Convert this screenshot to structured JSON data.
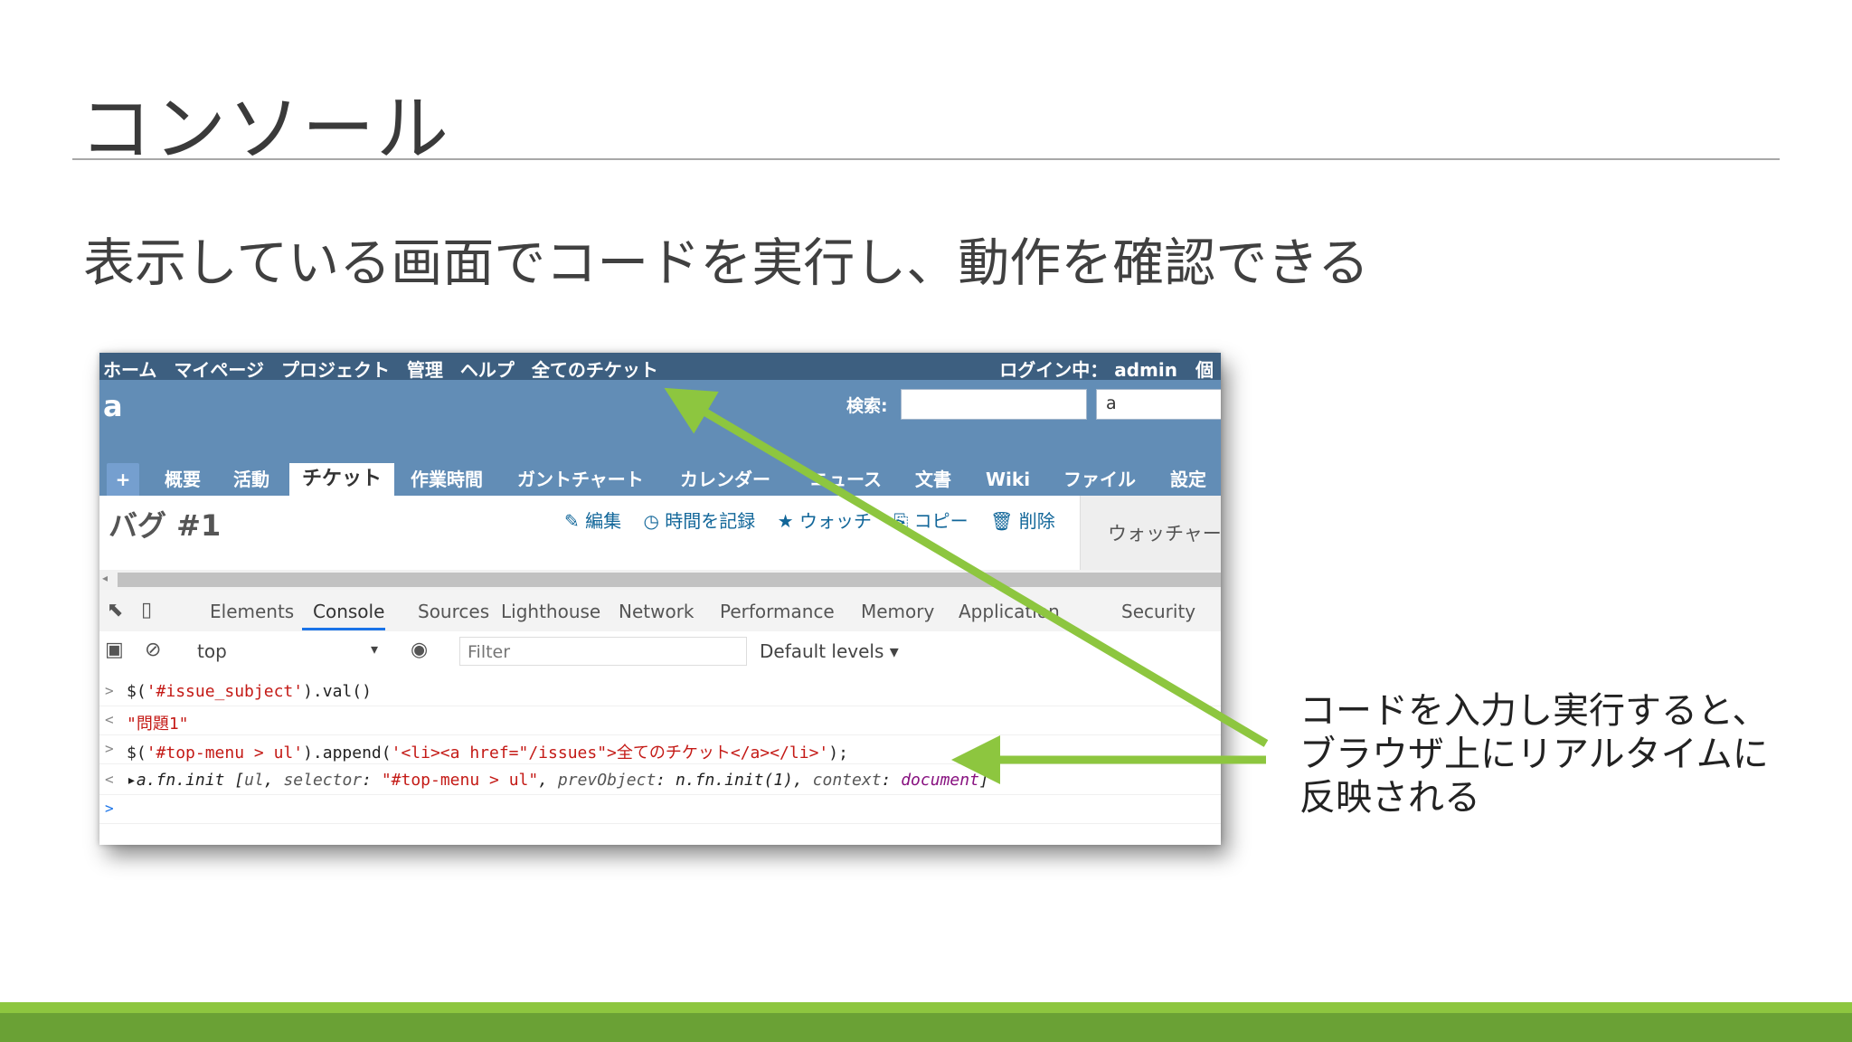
{
  "slide": {
    "title": "コンソール",
    "subtitle": "表示している画面でコードを実行し、動作を確認できる",
    "callout": [
      "コードを入力し実行すると、",
      "ブラウザ上にリアルタイムに",
      "反映される"
    ]
  },
  "redmine": {
    "top_menu": [
      "ホーム",
      "マイページ",
      "プロジェクト",
      "管理",
      "ヘルプ",
      "全てのチケット"
    ],
    "login_text": "ログイン中： admin　個",
    "project_name": "a",
    "search_label": "検索:",
    "project_select_value": "a",
    "tabs": [
      "+",
      "概要",
      "活動",
      "チケット",
      "作業時間",
      "ガントチャート",
      "カレンダー",
      "ニュース",
      "文書",
      "Wiki",
      "ファイル",
      "設定"
    ],
    "selected_tab": "チケット",
    "issue_title": "バグ #1",
    "actions": [
      "✎ 編集",
      "◷ 時間を記録",
      "★ ウォッチ",
      "⎘ コピー",
      "🗑 削除"
    ],
    "sidebar_title": "ウォッチャー"
  },
  "devtools": {
    "tabs": [
      "Elements",
      "Console",
      "Sources",
      "Lighthouse",
      "Network",
      "Performance",
      "Memory",
      "Application",
      "Security"
    ],
    "active_tab": "Console",
    "context": "top",
    "filter_placeholder": "Filter",
    "levels": "Default levels ▾",
    "console_lines": [
      {
        "prefix": ">",
        "parts": [
          [
            "c-plain",
            "$("
          ],
          [
            "c-str",
            "'#issue_subject'"
          ],
          [
            "c-plain",
            ").val()"
          ]
        ]
      },
      {
        "prefix": "<",
        "parts": [
          [
            "c-str",
            "\"問題1\""
          ]
        ]
      },
      {
        "prefix": ">",
        "parts": [
          [
            "c-plain",
            "$("
          ],
          [
            "c-str",
            "'#top-menu > ul'"
          ],
          [
            "c-plain",
            ").append("
          ],
          [
            "c-str",
            "'<li><a href=\"/issues\">全てのチケット</a></li>'"
          ],
          [
            "c-plain",
            ");"
          ]
        ]
      },
      {
        "prefix": "<",
        "parts": [
          [
            "c-plain",
            "▸"
          ],
          [
            "c-it",
            "a.fn.init ["
          ],
          [
            "c-key",
            "ul"
          ],
          [
            "c-it",
            ", "
          ],
          [
            "c-key",
            "selector"
          ],
          [
            "c-it",
            ": "
          ],
          [
            "c-str",
            "\"#top-menu > ul\""
          ],
          [
            "c-it",
            ", "
          ],
          [
            "c-key",
            "prevObject"
          ],
          [
            "c-it",
            ": n.fn.init(1), "
          ],
          [
            "c-key",
            "context"
          ],
          [
            "c-it",
            ": "
          ],
          [
            "c-val",
            "document"
          ],
          [
            "c-it",
            "]"
          ]
        ]
      },
      {
        "prefix": ">",
        "parts": []
      }
    ]
  },
  "colors": {
    "arrow": "#8dc63f",
    "redmine_header": "#628db6",
    "redmine_topmenu": "#3d5f80",
    "footer_light": "#8dc63f",
    "footer_dark": "#6aa135"
  }
}
